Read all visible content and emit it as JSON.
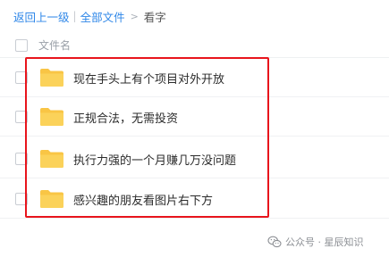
{
  "breadcrumb": {
    "back": "返回上一级",
    "separator": "|",
    "all_files": "全部文件",
    "arrow": ">",
    "current": "看字"
  },
  "table": {
    "header_name": "文件名"
  },
  "files": [
    {
      "name": "现在手头上有个项目对外开放",
      "icon": "folder-icon"
    },
    {
      "name": "正规合法，无需投资",
      "icon": "folder-icon"
    },
    {
      "name": "执行力强的一个月赚几万没问题",
      "icon": "folder-icon"
    },
    {
      "name": "感兴趣的朋友看图片右下方",
      "icon": "folder-icon"
    }
  ],
  "watermark": {
    "icon": "wechat-icon",
    "text": "公众号 · 星辰知识"
  },
  "colors": {
    "link": "#2f87e8",
    "folder": "#f9c545",
    "highlight": "#e8141c"
  }
}
